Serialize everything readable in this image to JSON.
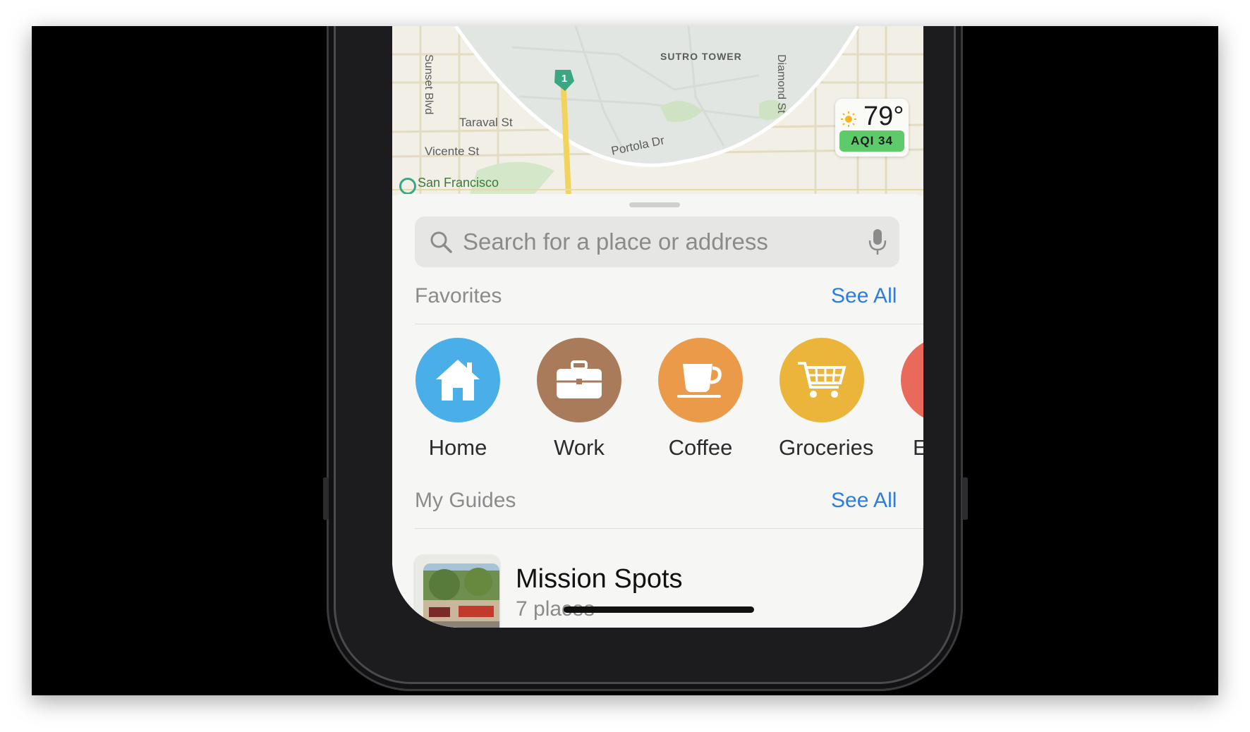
{
  "map": {
    "labels": {
      "sutro": "SUTRO TOWER",
      "sunset": "Sunset Blvd",
      "taraval": "Taraval St",
      "vicente": "Vicente St",
      "portola": "Portola Dr",
      "diamond": "Diamond St",
      "sf": "San Francisco"
    },
    "route_shield": "1"
  },
  "weather": {
    "temp": "79°",
    "aqi": "AQI 34",
    "icon": "sun-icon"
  },
  "search": {
    "placeholder": "Search for a place or address"
  },
  "favorites": {
    "title": "Favorites",
    "see_all": "See All",
    "items": [
      {
        "label": "Home",
        "icon": "house-icon",
        "color": "#4aaee8"
      },
      {
        "label": "Work",
        "icon": "briefcase-icon",
        "color": "#a97b5b"
      },
      {
        "label": "Coffee",
        "icon": "coffee-cup-icon",
        "color": "#eb9a4a"
      },
      {
        "label": "Groceries",
        "icon": "cart-icon",
        "color": "#ebb43a"
      },
      {
        "label": "E",
        "icon": "partial-icon",
        "color": "#e9695a"
      }
    ]
  },
  "guides": {
    "title": "My Guides",
    "see_all": "See All",
    "items": [
      {
        "title": "Mission Spots",
        "subtitle": "7 places"
      }
    ]
  }
}
